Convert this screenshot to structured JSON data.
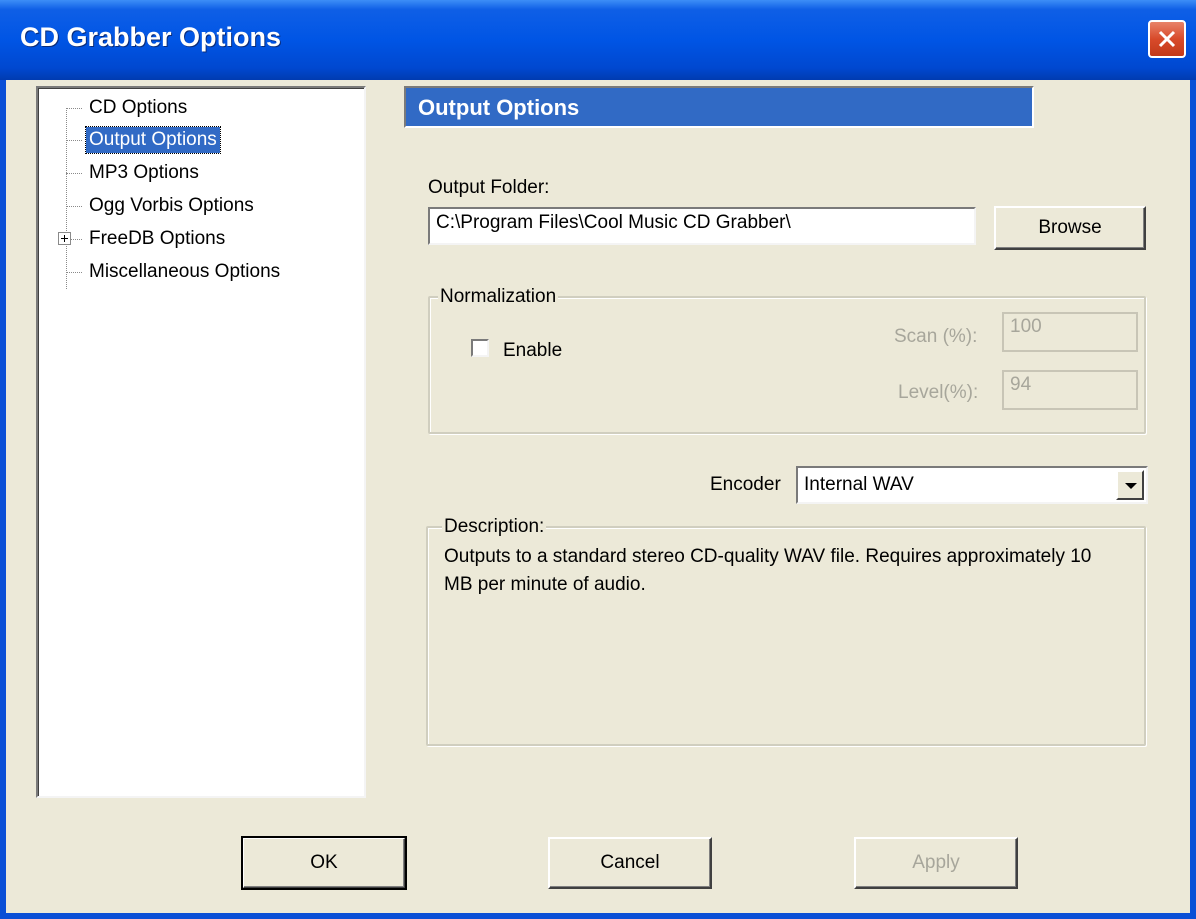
{
  "window": {
    "title": "CD Grabber Options"
  },
  "tree": {
    "items": [
      {
        "label": "CD Options",
        "selected": false,
        "expandable": false
      },
      {
        "label": "Output Options",
        "selected": true,
        "expandable": false
      },
      {
        "label": "MP3 Options",
        "selected": false,
        "expandable": false
      },
      {
        "label": "Ogg Vorbis Options",
        "selected": false,
        "expandable": false
      },
      {
        "label": "FreeDB Options",
        "selected": false,
        "expandable": true
      },
      {
        "label": "Miscellaneous Options",
        "selected": false,
        "expandable": false
      }
    ]
  },
  "panel": {
    "header": "Output Options",
    "output_folder": {
      "label": "Output Folder:",
      "value": "C:\\Program Files\\Cool Music CD Grabber\\",
      "browse_label": "Browse"
    },
    "normalization": {
      "legend": "Normalization",
      "enable_label": "Enable",
      "enabled": false,
      "scan_label": "Scan (%):",
      "scan_value": "100",
      "level_label": "Level(%):",
      "level_value": "94"
    },
    "encoder": {
      "label": "Encoder",
      "selected": "Internal WAV"
    },
    "description": {
      "legend": "Description:",
      "text": "Outputs to a standard stereo CD-quality WAV file.  Requires approximately 10 MB per minute of audio."
    }
  },
  "footer": {
    "ok_label": "OK",
    "cancel_label": "Cancel",
    "apply_label": "Apply"
  },
  "colors": {
    "titlebar": "#0055e5",
    "selection": "#316ac5",
    "dialog_bg": "#ece9d8",
    "close_button": "#d84a2a",
    "disabled_text": "#a7a69b"
  }
}
